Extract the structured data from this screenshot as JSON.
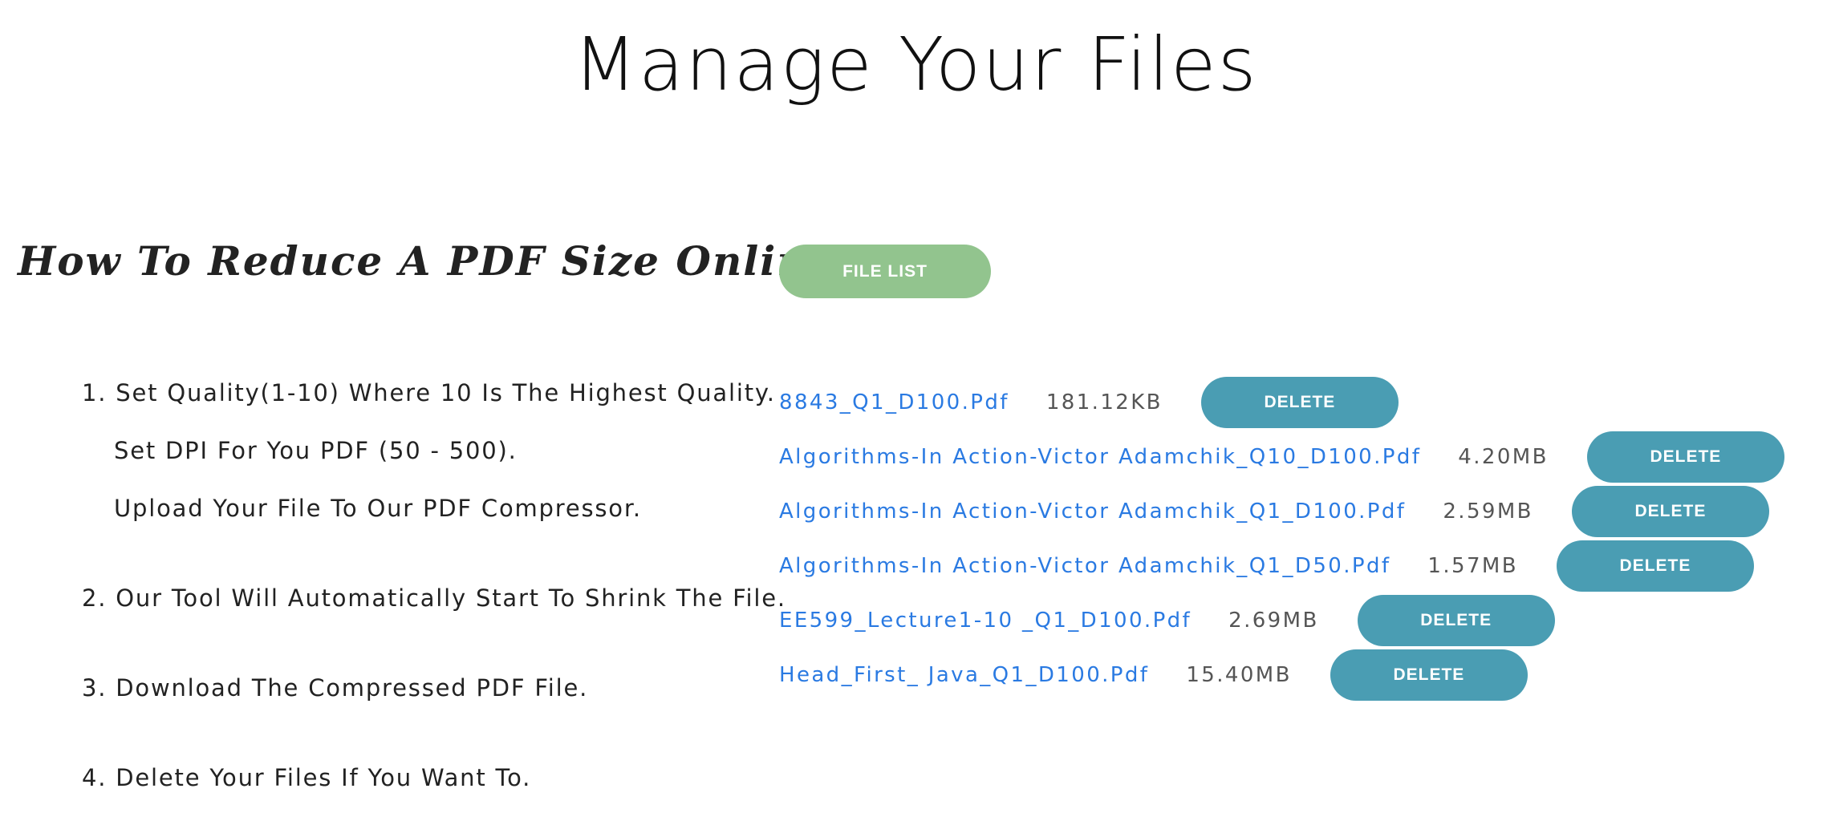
{
  "page_title": "Manage Your Files",
  "howto": {
    "heading": "How To Reduce A PDF Size Online:",
    "steps": [
      "1. Set Quality(1-10) Where 10 Is The Highest Quality.",
      "Set DPI For You PDF (50 - 500).",
      "Upload Your File To Our PDF Compressor.",
      "2. Our Tool Will Automatically Start To Shrink The File.",
      "3. Download The Compressed PDF File.",
      "4. Delete Your Files If You Want To."
    ]
  },
  "file_list_button": "FILE LIST",
  "files": [
    {
      "name": "8843_Q1_D100.Pdf",
      "size": "181.12KB",
      "action": "DELETE"
    },
    {
      "name": "Algorithms-In Action-Victor Adamchik_Q10_D100.Pdf",
      "size": "4.20MB",
      "action": "DELETE"
    },
    {
      "name": "Algorithms-In Action-Victor Adamchik_Q1_D100.Pdf",
      "size": "2.59MB",
      "action": "DELETE"
    },
    {
      "name": "Algorithms-In Action-Victor Adamchik_Q1_D50.Pdf",
      "size": "1.57MB",
      "action": "DELETE"
    },
    {
      "name": "EE599_Lecture1-10 _Q1_D100.Pdf",
      "size": "2.69MB",
      "action": "DELETE"
    },
    {
      "name": "Head_First_ Java_Q1_D100.Pdf",
      "size": "15.40MB",
      "action": "DELETE"
    }
  ],
  "colors": {
    "file_list_button": "#92c48e",
    "delete_button": "#4a9db3",
    "file_link": "#2a7ae2"
  }
}
